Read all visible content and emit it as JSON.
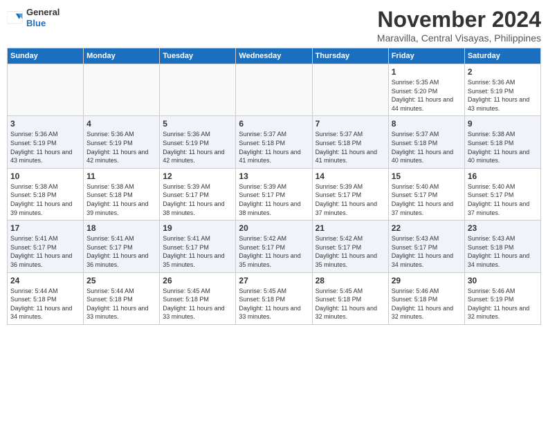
{
  "logo": {
    "general": "General",
    "blue": "Blue"
  },
  "title": "November 2024",
  "subtitle": "Maravilla, Central Visayas, Philippines",
  "days_of_week": [
    "Sunday",
    "Monday",
    "Tuesday",
    "Wednesday",
    "Thursday",
    "Friday",
    "Saturday"
  ],
  "weeks": [
    [
      {
        "day": "",
        "info": ""
      },
      {
        "day": "",
        "info": ""
      },
      {
        "day": "",
        "info": ""
      },
      {
        "day": "",
        "info": ""
      },
      {
        "day": "",
        "info": ""
      },
      {
        "day": "1",
        "info": "Sunrise: 5:35 AM\nSunset: 5:20 PM\nDaylight: 11 hours and 44 minutes."
      },
      {
        "day": "2",
        "info": "Sunrise: 5:36 AM\nSunset: 5:19 PM\nDaylight: 11 hours and 43 minutes."
      }
    ],
    [
      {
        "day": "3",
        "info": "Sunrise: 5:36 AM\nSunset: 5:19 PM\nDaylight: 11 hours and 43 minutes."
      },
      {
        "day": "4",
        "info": "Sunrise: 5:36 AM\nSunset: 5:19 PM\nDaylight: 11 hours and 42 minutes."
      },
      {
        "day": "5",
        "info": "Sunrise: 5:36 AM\nSunset: 5:19 PM\nDaylight: 11 hours and 42 minutes."
      },
      {
        "day": "6",
        "info": "Sunrise: 5:37 AM\nSunset: 5:18 PM\nDaylight: 11 hours and 41 minutes."
      },
      {
        "day": "7",
        "info": "Sunrise: 5:37 AM\nSunset: 5:18 PM\nDaylight: 11 hours and 41 minutes."
      },
      {
        "day": "8",
        "info": "Sunrise: 5:37 AM\nSunset: 5:18 PM\nDaylight: 11 hours and 40 minutes."
      },
      {
        "day": "9",
        "info": "Sunrise: 5:38 AM\nSunset: 5:18 PM\nDaylight: 11 hours and 40 minutes."
      }
    ],
    [
      {
        "day": "10",
        "info": "Sunrise: 5:38 AM\nSunset: 5:18 PM\nDaylight: 11 hours and 39 minutes."
      },
      {
        "day": "11",
        "info": "Sunrise: 5:38 AM\nSunset: 5:18 PM\nDaylight: 11 hours and 39 minutes."
      },
      {
        "day": "12",
        "info": "Sunrise: 5:39 AM\nSunset: 5:17 PM\nDaylight: 11 hours and 38 minutes."
      },
      {
        "day": "13",
        "info": "Sunrise: 5:39 AM\nSunset: 5:17 PM\nDaylight: 11 hours and 38 minutes."
      },
      {
        "day": "14",
        "info": "Sunrise: 5:39 AM\nSunset: 5:17 PM\nDaylight: 11 hours and 37 minutes."
      },
      {
        "day": "15",
        "info": "Sunrise: 5:40 AM\nSunset: 5:17 PM\nDaylight: 11 hours and 37 minutes."
      },
      {
        "day": "16",
        "info": "Sunrise: 5:40 AM\nSunset: 5:17 PM\nDaylight: 11 hours and 37 minutes."
      }
    ],
    [
      {
        "day": "17",
        "info": "Sunrise: 5:41 AM\nSunset: 5:17 PM\nDaylight: 11 hours and 36 minutes."
      },
      {
        "day": "18",
        "info": "Sunrise: 5:41 AM\nSunset: 5:17 PM\nDaylight: 11 hours and 36 minutes."
      },
      {
        "day": "19",
        "info": "Sunrise: 5:41 AM\nSunset: 5:17 PM\nDaylight: 11 hours and 35 minutes."
      },
      {
        "day": "20",
        "info": "Sunrise: 5:42 AM\nSunset: 5:17 PM\nDaylight: 11 hours and 35 minutes."
      },
      {
        "day": "21",
        "info": "Sunrise: 5:42 AM\nSunset: 5:17 PM\nDaylight: 11 hours and 35 minutes."
      },
      {
        "day": "22",
        "info": "Sunrise: 5:43 AM\nSunset: 5:17 PM\nDaylight: 11 hours and 34 minutes."
      },
      {
        "day": "23",
        "info": "Sunrise: 5:43 AM\nSunset: 5:18 PM\nDaylight: 11 hours and 34 minutes."
      }
    ],
    [
      {
        "day": "24",
        "info": "Sunrise: 5:44 AM\nSunset: 5:18 PM\nDaylight: 11 hours and 34 minutes."
      },
      {
        "day": "25",
        "info": "Sunrise: 5:44 AM\nSunset: 5:18 PM\nDaylight: 11 hours and 33 minutes."
      },
      {
        "day": "26",
        "info": "Sunrise: 5:45 AM\nSunset: 5:18 PM\nDaylight: 11 hours and 33 minutes."
      },
      {
        "day": "27",
        "info": "Sunrise: 5:45 AM\nSunset: 5:18 PM\nDaylight: 11 hours and 33 minutes."
      },
      {
        "day": "28",
        "info": "Sunrise: 5:45 AM\nSunset: 5:18 PM\nDaylight: 11 hours and 32 minutes."
      },
      {
        "day": "29",
        "info": "Sunrise: 5:46 AM\nSunset: 5:18 PM\nDaylight: 11 hours and 32 minutes."
      },
      {
        "day": "30",
        "info": "Sunrise: 5:46 AM\nSunset: 5:19 PM\nDaylight: 11 hours and 32 minutes."
      }
    ]
  ]
}
